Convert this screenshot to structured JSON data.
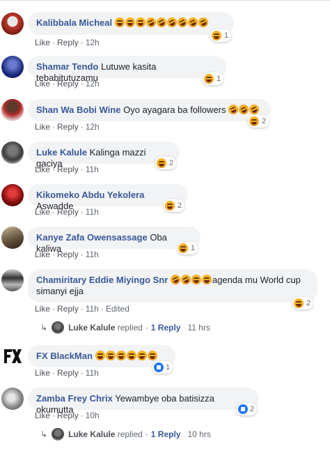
{
  "actions": {
    "like": "Like",
    "reply": "Reply",
    "separator": "·",
    "edited": "Edited"
  },
  "comments": [
    {
      "author": "Kalibbala Micheal",
      "text": "",
      "emoji_count": 9,
      "time": "12h",
      "reaction": "1"
    },
    {
      "author": "Shamar Tendo",
      "text": "Lutuwe kasita tebabitutuzamu",
      "time": "12h",
      "reaction": "1"
    },
    {
      "author": "Shan Wa Bobi Wine",
      "text": "Oyo ayagara ba followers",
      "time": "12h",
      "reaction": "2"
    },
    {
      "author": "Luke Kalule",
      "text": "Kalinga mazzi gaciya",
      "time": "11h",
      "reaction": "2"
    },
    {
      "author": "Kikomeko Abdu Yekolera",
      "text": "Aswadde",
      "time": "11h",
      "reaction": "2"
    },
    {
      "author": "Kanye Zafa Owensassage",
      "text": "Oba kaliwa",
      "time": "11h",
      "reaction": "1"
    },
    {
      "author": "Chamiritary Eddie Miyingo Snr",
      "text_line1": "agenda mu World cup",
      "text_line2": "simanyi ejja",
      "time": "11h",
      "reaction": "2"
    },
    {
      "author": "FX BlackMan",
      "text": "",
      "time": "11h",
      "reaction": "1"
    },
    {
      "author": "Zamba Frey Chrix",
      "text": "Yewambye oba batisizza okumutta",
      "time": "10h",
      "reaction": "2"
    }
  ],
  "replies": [
    {
      "name": "Luke Kalule",
      "replied": "replied",
      "link": "1 Reply",
      "time": "11 hrs"
    },
    {
      "name": "Luke Kalule",
      "replied": "replied",
      "link": "1 Reply",
      "time": "10 hrs"
    }
  ],
  "colors": {
    "author": "#385898",
    "bubble": "#f2f3f5",
    "haha": "#f7b125",
    "like": "#2078f4"
  }
}
